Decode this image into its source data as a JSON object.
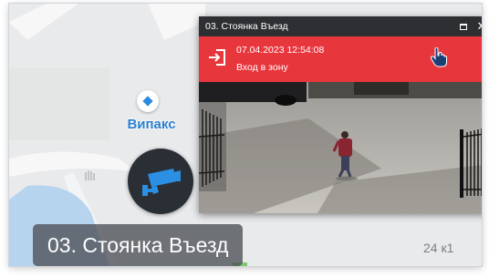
{
  "map": {
    "poi_label": "Випакс",
    "house_number": "24 к1",
    "camera_label": "03. Стоянка Въезд"
  },
  "icons": {
    "poi": "location-diamond-icon",
    "camera_marker": "security-camera-icon",
    "alert": "sign-in-icon",
    "cursor": "hand-pointer-icon",
    "maximize": "maximize-icon",
    "close": "close-icon"
  },
  "popup": {
    "title": "03. Стоянка Въезд",
    "close_glyph": "✕",
    "alert": {
      "timestamp": "07.04.2023 12:54:08",
      "event": "Вход в зону",
      "color": "#e8363d"
    }
  },
  "colors": {
    "map_background": "#e9eaec",
    "titlebar": "#2e2f33",
    "poi_text": "#2b7fcf"
  }
}
